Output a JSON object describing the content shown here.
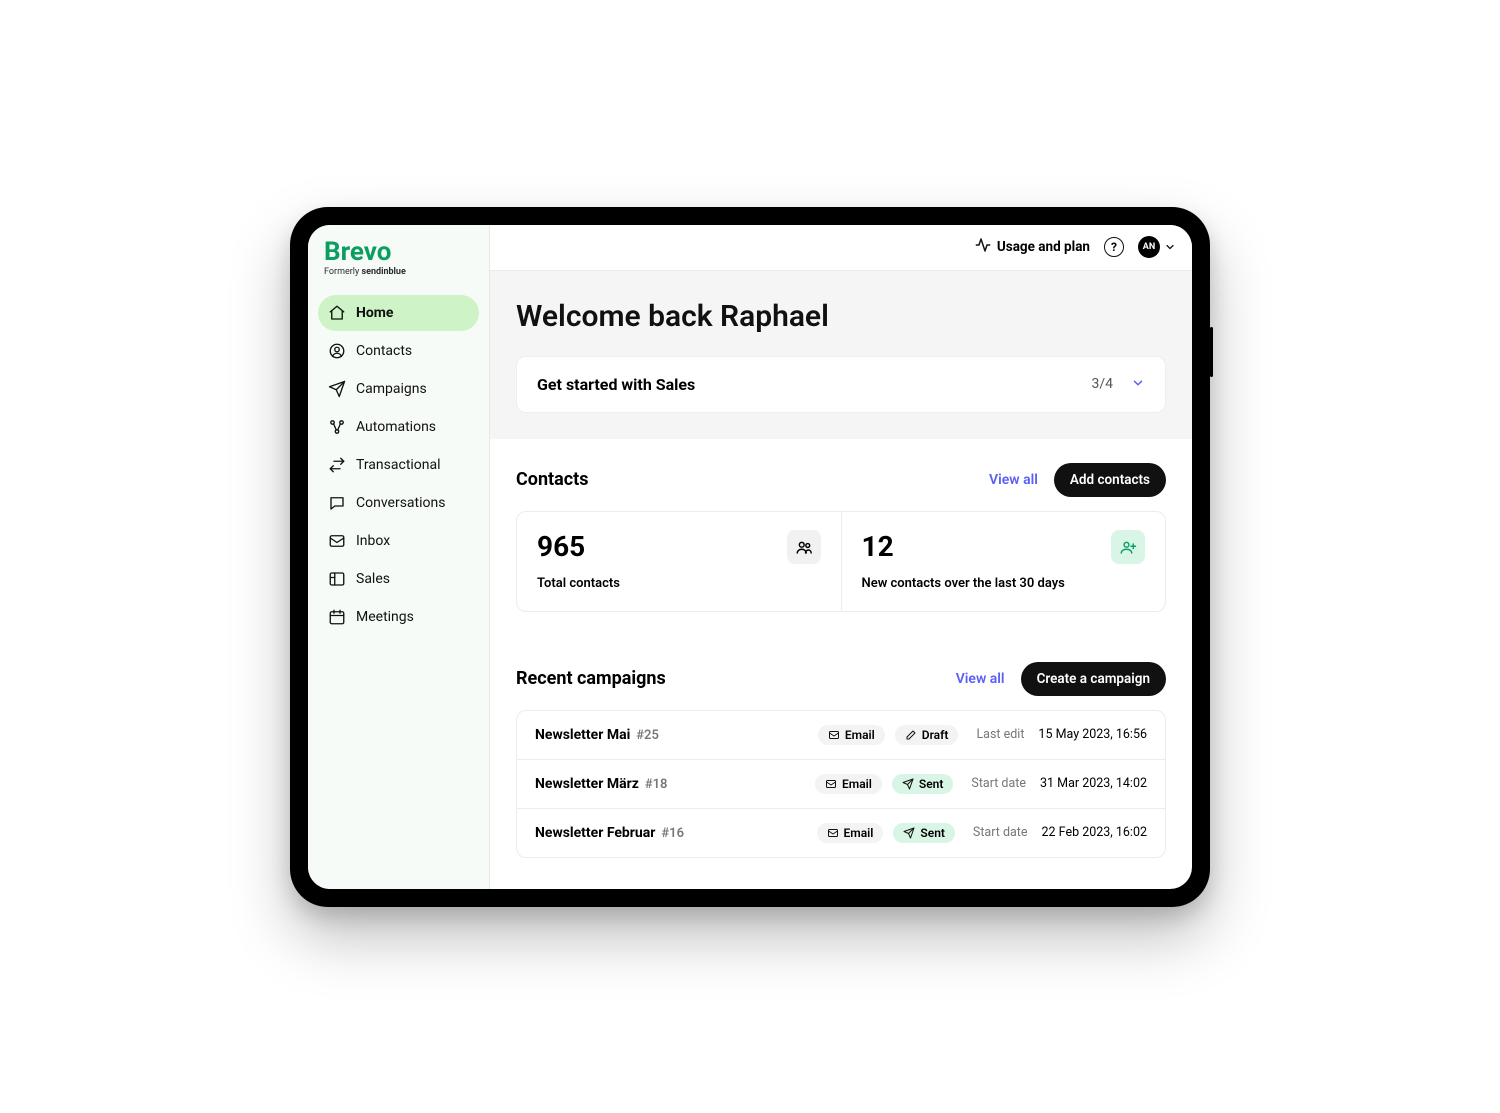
{
  "brand": {
    "name": "Brevo",
    "tagline_prefix": "Formerly ",
    "tagline_bold": "sendinblue"
  },
  "sidebar": {
    "items": [
      {
        "label": "Home",
        "icon": "home-icon",
        "active": true
      },
      {
        "label": "Contacts",
        "icon": "user-circle-icon",
        "active": false
      },
      {
        "label": "Campaigns",
        "icon": "send-icon",
        "active": false
      },
      {
        "label": "Automations",
        "icon": "nodes-icon",
        "active": false
      },
      {
        "label": "Transactional",
        "icon": "swap-icon",
        "active": false
      },
      {
        "label": "Conversations",
        "icon": "chat-icon",
        "active": false
      },
      {
        "label": "Inbox",
        "icon": "inbox-icon",
        "active": false
      },
      {
        "label": "Sales",
        "icon": "layout-icon",
        "active": false
      },
      {
        "label": "Meetings",
        "icon": "calendar-icon",
        "active": false
      }
    ]
  },
  "topbar": {
    "usage_label": "Usage and plan",
    "help_glyph": "?",
    "avatar_initials": "AN"
  },
  "hero": {
    "welcome": "Welcome back Raphael",
    "onboarding": {
      "title": "Get started with Sales",
      "progress": "3/4"
    }
  },
  "contacts_section": {
    "title": "Contacts",
    "view_all": "View all",
    "add_btn": "Add contacts",
    "cards": [
      {
        "value": "965",
        "label": "Total contacts",
        "icon": "group-icon",
        "variant": "gray"
      },
      {
        "value": "12",
        "label": "New contacts over the last 30 days",
        "icon": "user-plus-icon",
        "variant": "green"
      }
    ]
  },
  "campaigns_section": {
    "title": "Recent campaigns",
    "view_all": "View all",
    "create_btn": "Create a campaign",
    "rows": [
      {
        "name": "Newsletter Mai",
        "id": "#25",
        "type": "Email",
        "status": "Draft",
        "status_kind": "draft",
        "meta_label": "Last edit",
        "meta_value": "15 May 2023, 16:56"
      },
      {
        "name": "Newsletter März",
        "id": "#18",
        "type": "Email",
        "status": "Sent",
        "status_kind": "sent",
        "meta_label": "Start date",
        "meta_value": "31 Mar 2023, 14:02"
      },
      {
        "name": "Newsletter Februar",
        "id": "#16",
        "type": "Email",
        "status": "Sent",
        "status_kind": "sent",
        "meta_label": "Start date",
        "meta_value": "22 Feb 2023, 16:02"
      }
    ]
  }
}
